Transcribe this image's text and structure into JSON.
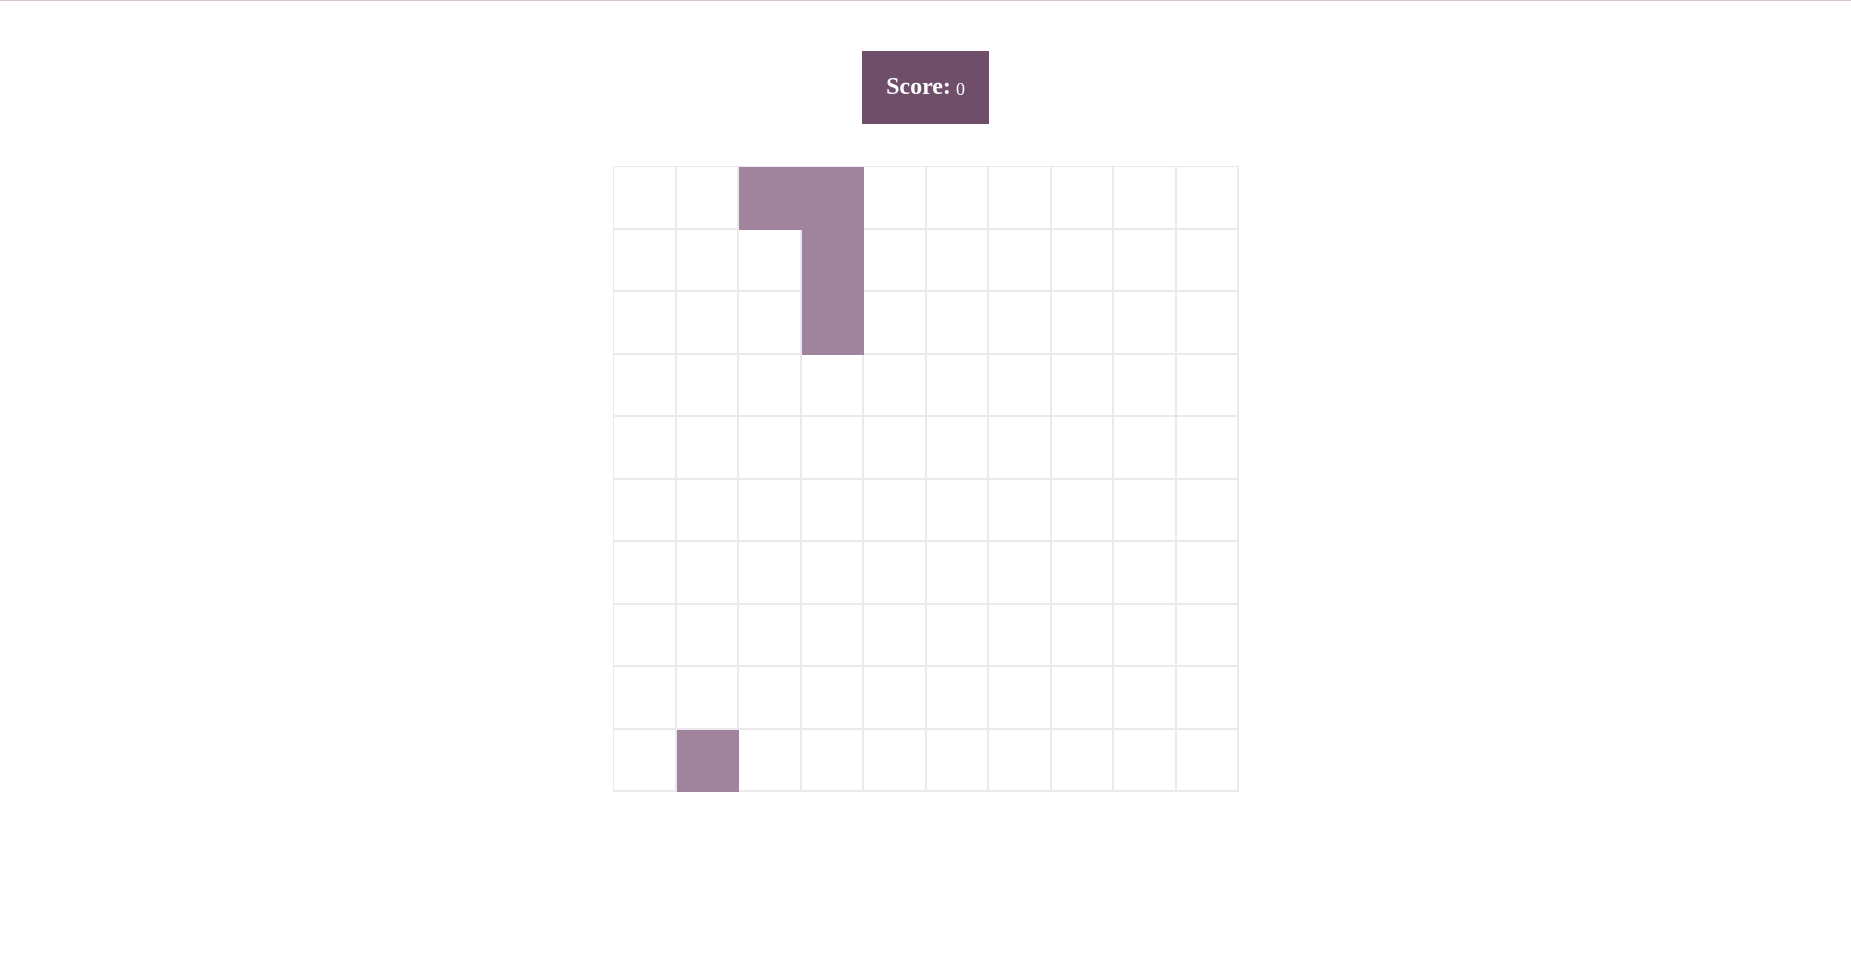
{
  "score": {
    "label": "Score:",
    "value": "0"
  },
  "board": {
    "rows": 10,
    "cols": 10,
    "filled_color": "#a0839d",
    "empty_color": "#ffffff",
    "grid_line_color": "#ece8ee",
    "filled_cells": [
      [
        0,
        2
      ],
      [
        0,
        3
      ],
      [
        1,
        3
      ],
      [
        2,
        3
      ],
      [
        9,
        1
      ]
    ]
  },
  "colors": {
    "score_background": "#6f4e6a",
    "score_text": "#ffffff"
  }
}
